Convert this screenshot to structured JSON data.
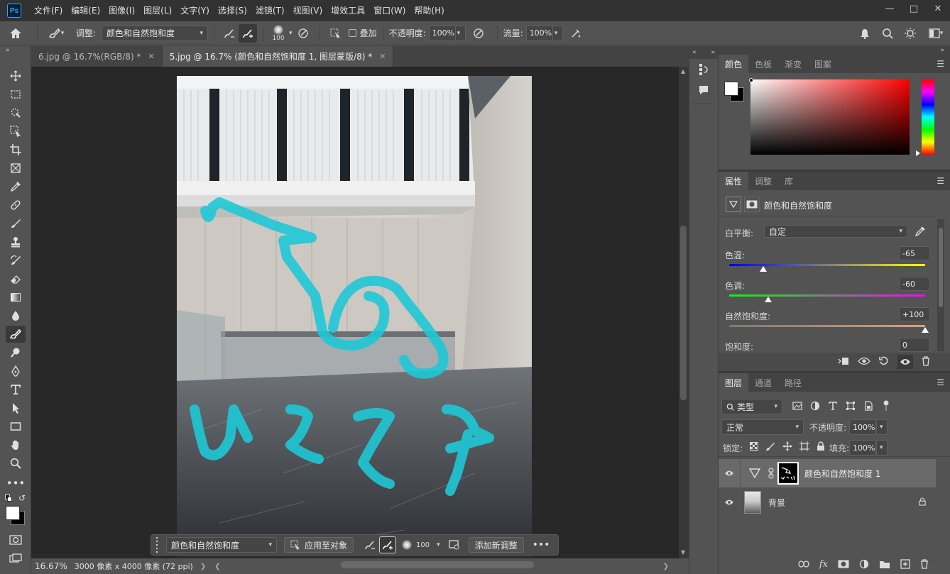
{
  "app": {
    "logo": "Ps"
  },
  "menu": [
    "文件(F)",
    "编辑(E)",
    "图像(I)",
    "图层(L)",
    "文字(Y)",
    "选择(S)",
    "滤镜(T)",
    "视图(V)",
    "增效工具",
    "窗口(W)",
    "帮助(H)"
  ],
  "options": {
    "adjust_label": "调整:",
    "adjust_value": "颜色和自然饱和度",
    "brush_size": "100",
    "overlay_label": "叠加",
    "opacity_label": "不透明度:",
    "opacity_value": "100%",
    "flow_label": "流量:",
    "flow_value": "100%"
  },
  "tabs": [
    {
      "label": "6.jpg @ 16.7%(RGB/8) *",
      "active": false
    },
    {
      "label": "5.jpg @ 16.7% (颜色和自然饱和度 1, 图层蒙版/8) *",
      "active": true
    }
  ],
  "ctxbar": {
    "adjust_value": "颜色和自然饱和度",
    "apply_label": "应用至对象",
    "brush_size": "100",
    "add_label": "添加新调整"
  },
  "status": {
    "zoom": "16.67%",
    "dims": "3000 像素 x 4000 像素 (72 ppi)"
  },
  "color_panel": {
    "tabs": [
      "颜色",
      "色板",
      "渐变",
      "图案"
    ]
  },
  "properties": {
    "tabs": [
      "属性",
      "调整",
      "库"
    ],
    "title": "颜色和自然饱和度",
    "wb_label": "白平衡:",
    "wb_value": "自定",
    "temp_label": "色温:",
    "temp_value": "-65",
    "temp_level": -65,
    "tint_label": "色调:",
    "tint_value": "-60",
    "tint_level": -60,
    "vib_label": "自然饱和度:",
    "vib_value": "+100",
    "vib_level": 100,
    "sat_label": "饱和度:",
    "sat_value": "0"
  },
  "layers_panel": {
    "tabs": [
      "图层",
      "通道",
      "路径"
    ],
    "filter_value": "类型",
    "blend_value": "正常",
    "opacity_label": "不透明度:",
    "opacity_value": "100%",
    "lock_label": "锁定:",
    "fill_label": "填充:",
    "fill_value": "100%",
    "layers": [
      {
        "name": "颜色和自然饱和度 1",
        "selected": true
      },
      {
        "name": "背景",
        "selected": false
      }
    ]
  },
  "colors": {
    "accent": "#31a8ff",
    "stroke": "#1ec8d6"
  }
}
